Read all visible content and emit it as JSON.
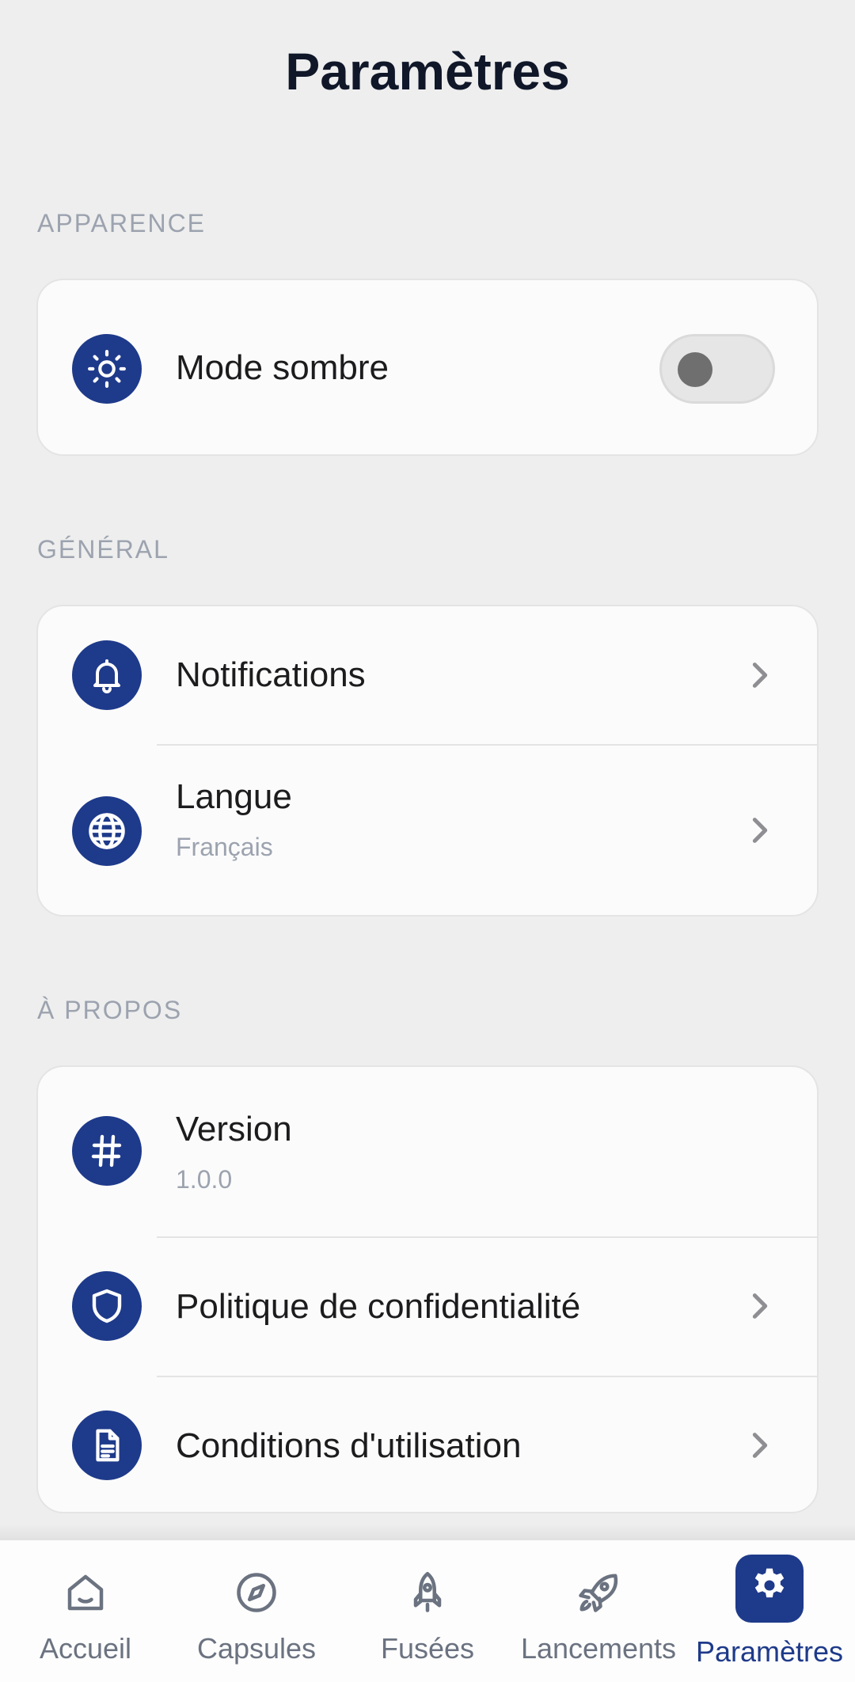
{
  "header": {
    "title": "Paramètres"
  },
  "sections": {
    "appearance": {
      "title": "APPARENCE",
      "dark_mode": {
        "label": "Mode sombre",
        "icon": "sun-icon",
        "enabled": false
      }
    },
    "general": {
      "title": "GÉNÉRAL",
      "notifications": {
        "label": "Notifications",
        "icon": "bell-icon"
      },
      "language": {
        "label": "Langue",
        "value": "Français",
        "icon": "globe-icon"
      }
    },
    "about": {
      "title": "À PROPOS",
      "version": {
        "label": "Version",
        "value": "1.0.0",
        "icon": "hash-icon"
      },
      "privacy": {
        "label": "Politique de confidentialité",
        "icon": "shield-icon"
      },
      "terms": {
        "label": "Conditions d'utilisation",
        "icon": "document-icon"
      }
    }
  },
  "tabbar": {
    "tabs": [
      {
        "label": "Accueil",
        "icon": "home-icon"
      },
      {
        "label": "Capsules",
        "icon": "compass-icon"
      },
      {
        "label": "Fusées",
        "icon": "rocket-icon"
      },
      {
        "label": "Lancements",
        "icon": "launch-rocket-icon"
      },
      {
        "label": "Paramètres",
        "icon": "gear-icon",
        "active": true
      }
    ]
  },
  "colors": {
    "accent": "#1e3a8a",
    "background": "#eeeeee",
    "card": "#fbfbfb",
    "muted_text": "#9ca3af"
  }
}
